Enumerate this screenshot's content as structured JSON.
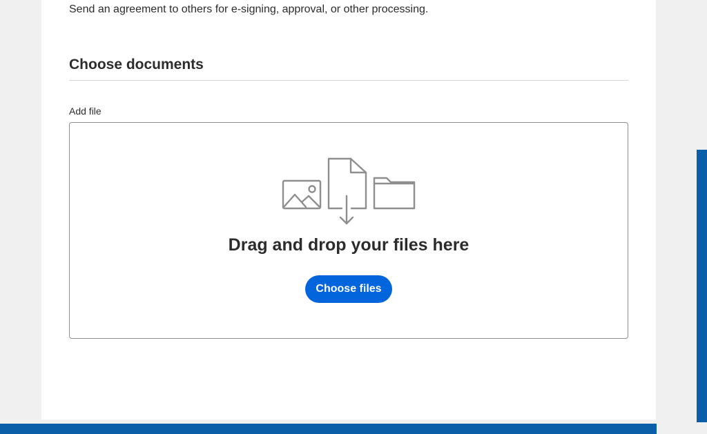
{
  "intro": {
    "description": "Send an agreement to others for e-signing, approval, or other processing."
  },
  "documents_section": {
    "title": "Choose documents",
    "add_file_label": "Add file",
    "dropzone": {
      "title": "Drag and drop your files here",
      "choose_button_label": "Choose files",
      "icons": [
        "image-icon",
        "file-download-icon",
        "folder-icon"
      ]
    }
  },
  "colors": {
    "accent": "#0265dc",
    "brand_bar": "#0b5ea8",
    "icon_gray": "#8e8e8e"
  }
}
